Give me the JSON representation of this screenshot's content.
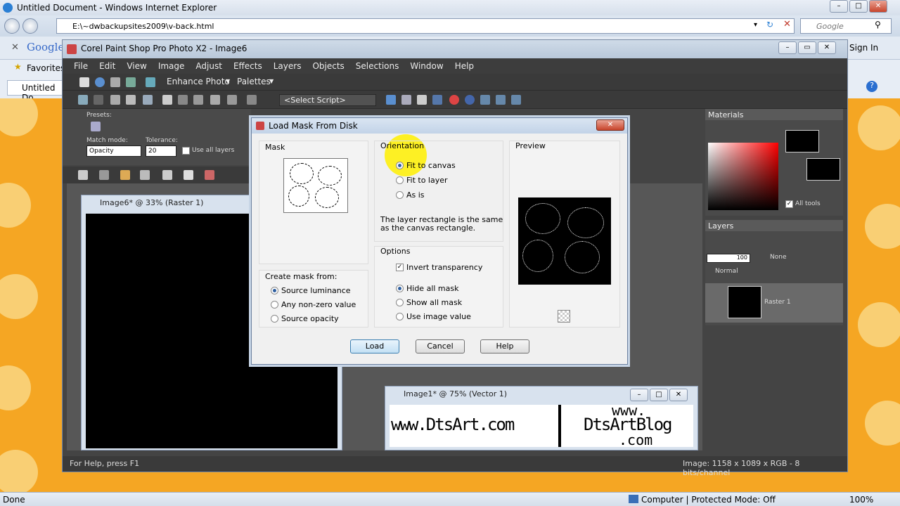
{
  "ie": {
    "title": "Untitled Document - Windows Internet Explorer",
    "address": "E:\\~dwbackupsites2009\\v-back.html",
    "search_placeholder": "Google",
    "google_label": "Google",
    "favorites": "Favorites",
    "tab": "Untitled Do",
    "sign_in": "Sign In",
    "status_left": "Done",
    "status_zone": "Computer | Protected Mode: Off",
    "zoom": "100%"
  },
  "psp": {
    "title": "Corel Paint Shop Pro Photo X2 - Image6",
    "menu": [
      "File",
      "Edit",
      "View",
      "Image",
      "Adjust",
      "Effects",
      "Layers",
      "Objects",
      "Selections",
      "Window",
      "Help"
    ],
    "enhance": "Enhance Photo",
    "palettes": "Palettes",
    "select_script": "<Select Script>",
    "presets": "Presets:",
    "match_mode_label": "Match mode:",
    "match_mode": "Opacity",
    "tolerance_label": "Tolerance:",
    "tolerance": "20",
    "use_all_layers": "Use all layers",
    "status_left": "For Help, press F1",
    "status_right": "Image:  1158 x 1089 x RGB - 8 bits/channel",
    "materials": "Materials",
    "all_tools": "All tools",
    "layers": "Layers",
    "opacity": "100",
    "blend_none": "None",
    "blend_mode": "Normal",
    "layer_name": "Raster 1",
    "image6_title": "Image6* @  33% (Raster 1)",
    "image1_title": "Image1* @  75% (Vector 1)",
    "banner_left": "www.DtsArt.com",
    "banner_right_1": "www.",
    "banner_right_2": "DtsArtBlog",
    "banner_right_3": ".com"
  },
  "dialog": {
    "title": "Load Mask From Disk",
    "mask": "Mask",
    "orientation": "Orientation",
    "fit_canvas": "Fit to canvas",
    "fit_layer": "Fit to layer",
    "as_is": "As is",
    "orientation_desc": "The layer rectangle is the same as the canvas rectangle.",
    "preview": "Preview",
    "create_from": "Create mask from:",
    "src_lum": "Source luminance",
    "non_zero": "Any non-zero value",
    "src_opacity": "Source opacity",
    "options": "Options",
    "invert": "Invert transparency",
    "hide_all": "Hide all mask",
    "show_all": "Show all mask",
    "use_image": "Use image value",
    "load": "Load",
    "cancel": "Cancel",
    "help": "Help"
  }
}
